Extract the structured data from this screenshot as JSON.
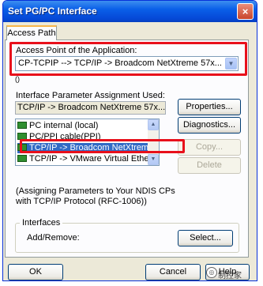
{
  "window": {
    "title": "Set PG/PC Interface",
    "close_glyph": "×"
  },
  "tabs": [
    {
      "label": "Access Path"
    }
  ],
  "access_point": {
    "label": "Access Point of the Application:",
    "value": "CP-TCPIP        --> TCP/IP -> Broadcom NetXtreme 57x...",
    "arrow": "▼",
    "sub_note": "()"
  },
  "interface_param": {
    "label": "Interface Parameter Assignment Used:",
    "value": "TCP/IP -> Broadcom NetXtreme 57x...",
    "items": [
      {
        "label": "PC internal (local)"
      },
      {
        "label": "PC/PPI cable(PPI)"
      },
      {
        "label": "TCP/IP -> Broadcom NetXtreme 57..."
      },
      {
        "label": "TCP/IP -> VMware Virtual Etheme..."
      }
    ],
    "selected_index": 2,
    "scroll_up": "▲",
    "scroll_down": "▼"
  },
  "buttons": {
    "properties": "Properties...",
    "diagnostics": "Diagnostics...",
    "copy": "Copy...",
    "delete": "Delete",
    "select": "Select...",
    "ok": "OK",
    "cancel": "Cancel",
    "help": "Help"
  },
  "info_text": {
    "line1": "(Assigning Parameters to Your NDIS CPs",
    "line2": "with TCP/IP Protocol (RFC-1006))"
  },
  "interfaces": {
    "group_label": "Interfaces",
    "add_remove_label": "Add/Remove:"
  },
  "watermark": {
    "text": "制控家",
    "icon": "◎"
  },
  "colors": {
    "highlight": "#e8101b",
    "selection": "#316ac5",
    "titlebar": "#0a5fe8"
  }
}
